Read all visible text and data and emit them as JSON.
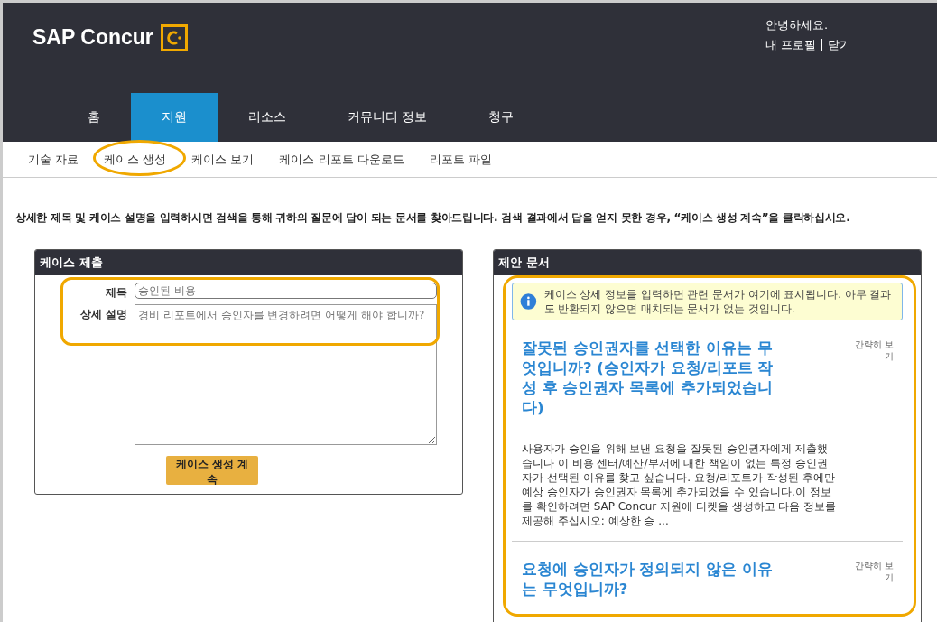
{
  "header": {
    "logo": "SAP Concur",
    "greeting": "안녕하세요.",
    "links": [
      "내 프로필",
      "닫기"
    ]
  },
  "tabs": [
    {
      "label": "홈",
      "selected": false
    },
    {
      "label": "지원",
      "selected": true
    },
    {
      "label": "리소스",
      "selected": false
    },
    {
      "label": "커뮤니티 정보",
      "selected": false
    },
    {
      "label": "청구",
      "selected": false
    }
  ],
  "subnav": [
    "기술 자료",
    "케이스 생성",
    "케이스 보기",
    "케이스 리포트 다운로드",
    "리포트 파일"
  ],
  "intro": "상세한 제목 및 케이스 설명을 입력하시면 검색을 통해 귀하의 질문에 답이 되는 문서를 찾아드립니다. 검색 결과에서 답을 얻지 못한 경우, “케이스 생성 계속”을 클릭하십시오.",
  "case_form": {
    "title": "케이스 제출",
    "subject_label": "제목",
    "subject_placeholder": "승인된 비용",
    "description_label": "상세 설명",
    "description_placeholder": "경비 리포트에서 승인자를 변경하려면 어떻게 해야 합니까?",
    "button": "케이스 생성 계속"
  },
  "suggested": {
    "title": "제안 문서",
    "info": "케이스 상세 정보를 입력하면 관련 문서가 여기에 표시됩니다. 아무 결과도 반환되지 않으면 매치되는 문서가 없는 것입니다.",
    "articles": [
      {
        "title": "잘못된 승인권자를 선택한 이유는 무엇입니까? (승인자가 요청/리포트 작성 후 승인권자 목록에 추가되었습니다)",
        "preview": "간략히 보기",
        "summary": "사용자가 승인을 위해 보낸 요청을 잘못된 승인권자에게 제출했습니다 이 비용 센터/예산/부서에 대한 책임이 없는 특정 승인권자가 선택된 이유를 찾고 싶습니다. 요청/리포트가 작성된 후에만 예상 승인자가 승인권자 목록에 추가되었을 수 있습니다.이 정보를 확인하려면 SAP Concur 지원에 티켓을 생성하고 다음 정보를 제공해 주십시오: 예상한 승 ..."
      },
      {
        "title": "요청에 승인자가 정의되지 않은 이유는 무엇입니까?",
        "preview": "간략히 보기"
      }
    ]
  }
}
